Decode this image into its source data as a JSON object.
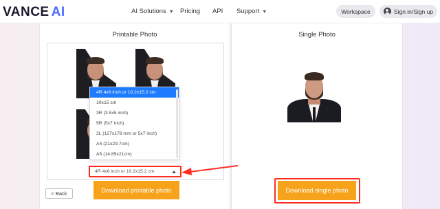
{
  "header": {
    "logo_main": "VANCE",
    "logo_accent": "AI",
    "nav": [
      {
        "label": "AI Solutions",
        "dropdown": true
      },
      {
        "label": "Pricing",
        "dropdown": false
      },
      {
        "label": "API",
        "dropdown": false
      },
      {
        "label": "Support",
        "dropdown": true
      }
    ],
    "workspace_label": "Workspace",
    "signin_label": "Sign in/Sign up"
  },
  "printable": {
    "title": "Printable Photo",
    "size_options": [
      "4R 4x6 inch or 10.2x15.2 cm",
      "10x15 cm",
      "3R (3.5x5 inch)",
      "5R (5x7 inch)",
      "2L (127x178 mm or 5x7 inch)",
      "A4 (21x29.7cm)",
      "A5 (14.85x21cm)"
    ],
    "selected_size": "4R 4x6 inch or 10.2x15.2 cm",
    "download_label": "Download printable photo",
    "back_label": "< Back"
  },
  "single": {
    "title": "Single Photo",
    "download_label": "Download single photo"
  },
  "colors": {
    "accent_orange": "#f7a21b",
    "highlight_red": "#ff2d20",
    "selected_blue": "#1e7bff",
    "logo_blue": "#4d6bff"
  }
}
